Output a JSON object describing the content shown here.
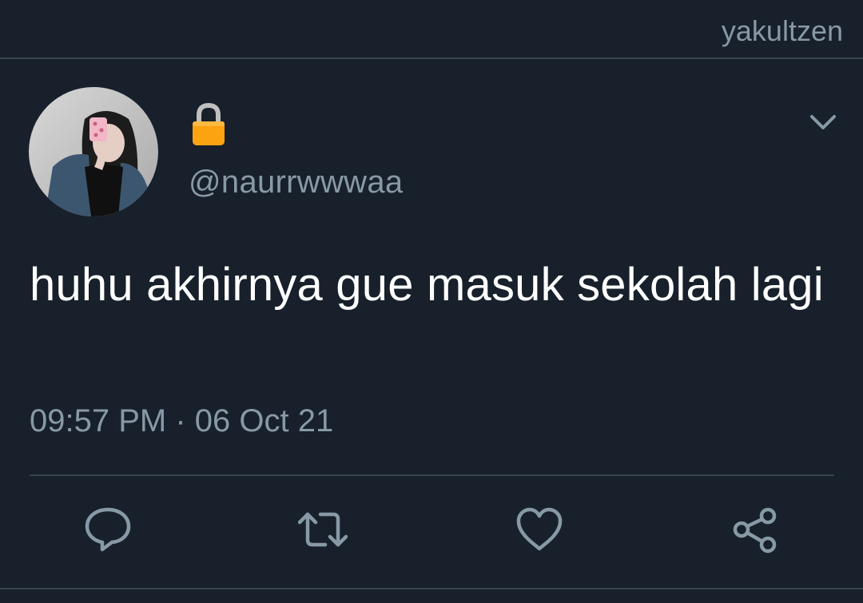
{
  "header": {
    "watermark": "yakultzen"
  },
  "tweet": {
    "display_name_icon": "lock-emoji",
    "handle": "@naurrwwwaa",
    "text": "huhu akhirnya gue masuk sekolah lagi",
    "time": "09:57 PM",
    "separator": "·",
    "date": "06 Oct 21"
  },
  "actions": [
    {
      "name": "reply",
      "icon": "speech-bubble-icon"
    },
    {
      "name": "retweet",
      "icon": "retweet-icon"
    },
    {
      "name": "like",
      "icon": "heart-icon"
    },
    {
      "name": "share",
      "icon": "share-icon"
    }
  ],
  "colors": {
    "background": "#17202b",
    "divider": "#38444f",
    "secondary_text": "#8899a6",
    "primary_text": "#ffffff",
    "lock": "#fca311"
  }
}
